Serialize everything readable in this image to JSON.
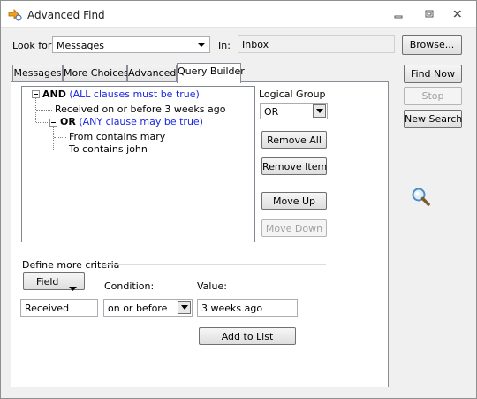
{
  "window": {
    "title": "Advanced Find",
    "icons": {
      "app": "advanced-find-icon",
      "minimize": "minimize-icon",
      "maximize": "maximize-icon",
      "close": "close-icon"
    }
  },
  "look_for": {
    "label": "Look for:",
    "value": "Messages",
    "in_label": "In:",
    "in_value": "Inbox"
  },
  "side_buttons": {
    "browse": "Browse...",
    "find_now": "Find Now",
    "stop": "Stop",
    "new_search": "New Search"
  },
  "tabs": [
    {
      "label": "Messages"
    },
    {
      "label": "More Choices"
    },
    {
      "label": "Advanced"
    },
    {
      "label": "Query Builder",
      "active": true
    }
  ],
  "tree": {
    "and_keyword": "AND",
    "and_desc": "(ALL clauses must be true)",
    "clause1": "Received on or before 3 weeks ago",
    "or_keyword": "OR",
    "or_desc": "(ANY clause may be true)",
    "clause2": "From contains mary",
    "clause3": "To contains john"
  },
  "logical_group": {
    "label": "Logical Group",
    "value": "OR"
  },
  "query_buttons": {
    "remove_all": "Remove All",
    "remove_item": "Remove Item",
    "move_up": "Move Up",
    "move_down": "Move Down"
  },
  "criteria": {
    "group_label": "Define more criteria",
    "field_button": "Field",
    "condition_label": "Condition:",
    "value_label": "Value:",
    "field_value": "Received",
    "condition_value": "on or before",
    "value_value": "3 weeks ago",
    "add_to_list": "Add to List"
  },
  "colors": {
    "window_bg": "#f0f0f0",
    "group_desc": "#1a26e0",
    "panel_border": "#898c95"
  }
}
